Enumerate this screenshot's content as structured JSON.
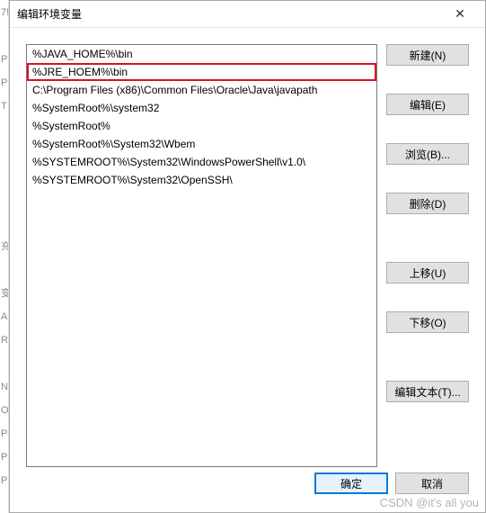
{
  "dialog": {
    "title": "编辑环境变量",
    "close_label": "✕"
  },
  "list": {
    "items": [
      "%JAVA_HOME%\\bin",
      "%JRE_HOEM%\\bin",
      "C:\\Program Files (x86)\\Common Files\\Oracle\\Java\\javapath",
      "%SystemRoot%\\system32",
      "%SystemRoot%",
      "%SystemRoot%\\System32\\Wbem",
      "%SYSTEMROOT%\\System32\\WindowsPowerShell\\v1.0\\",
      "%SYSTEMROOT%\\System32\\OpenSSH\\"
    ],
    "highlighted_index": 1
  },
  "buttons": {
    "new": "新建(N)",
    "edit": "编辑(E)",
    "browse": "浏览(B)...",
    "delete": "删除(D)",
    "move_up": "上移(U)",
    "move_down": "下移(O)",
    "edit_text": "编辑文本(T)...",
    "ok": "确定",
    "cancel": "取消"
  },
  "bg_fragments": [
    "7!",
    "",
    "P",
    "Pa",
    "T",
    "",
    "",
    "",
    "",
    "",
    "充",
    "",
    "变",
    "A",
    "R",
    "",
    "N",
    "O",
    "Pa",
    "Pa",
    "PF"
  ],
  "watermark": "CSDN @it's all you"
}
